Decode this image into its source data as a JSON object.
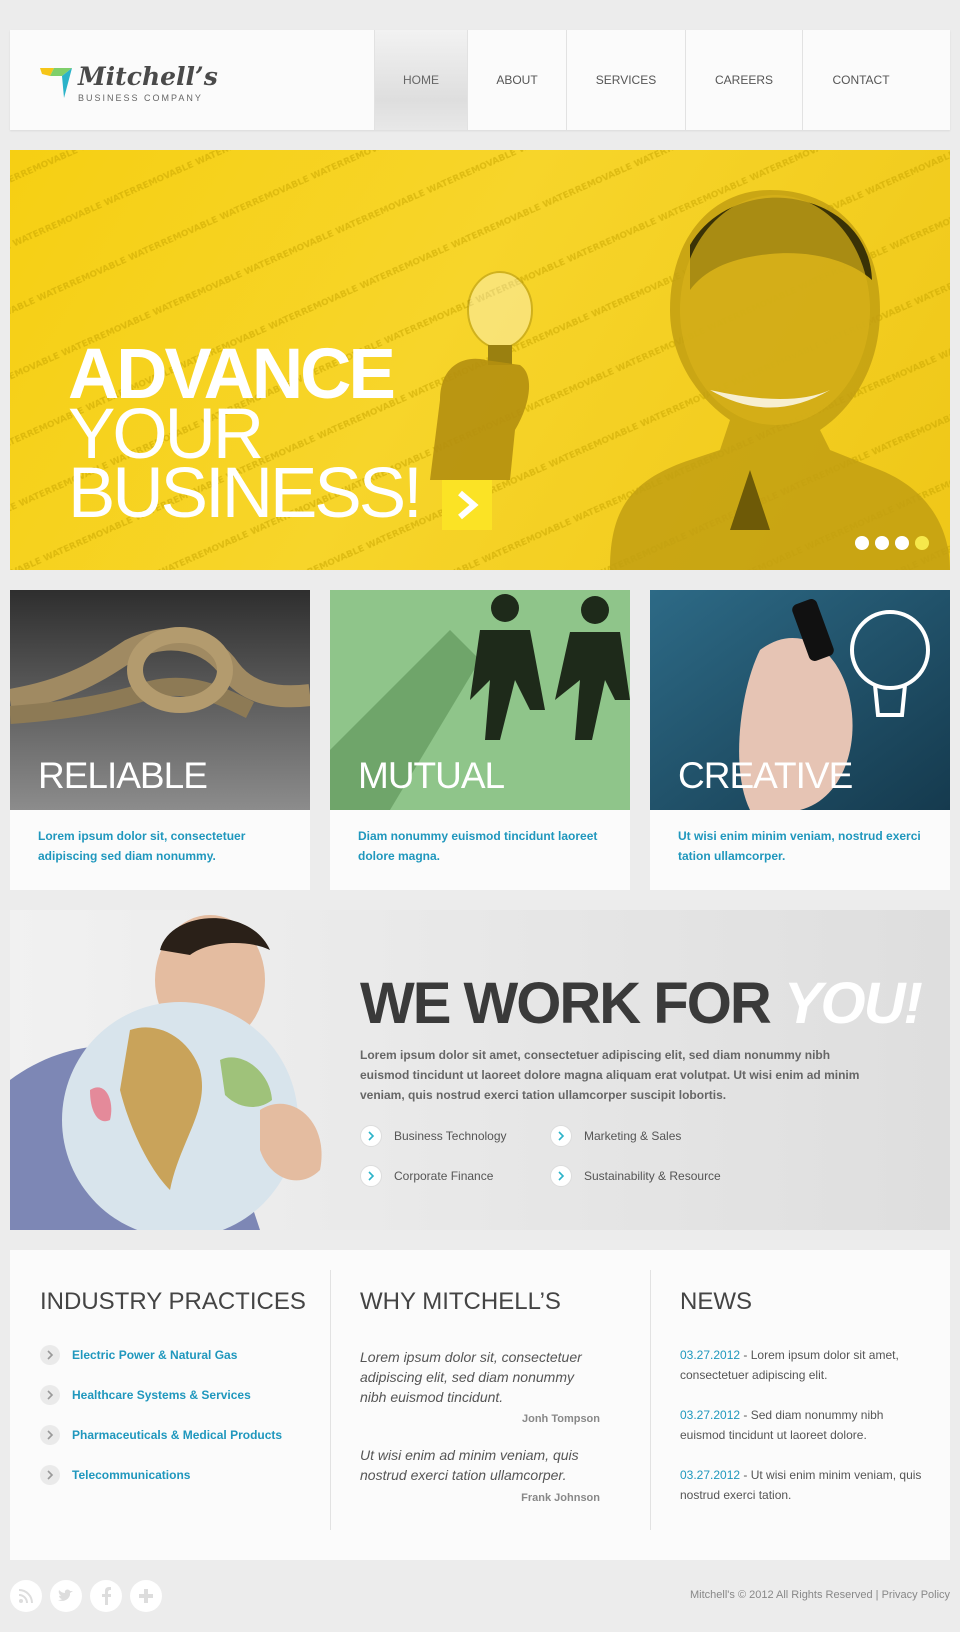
{
  "header": {
    "logo_title": "Mitchell’s",
    "logo_sub": "BUSINESS COMPANY",
    "nav": [
      "HOME",
      "ABOUT",
      "SERVICES",
      "CAREERS",
      "CONTACT"
    ]
  },
  "hero": {
    "line1": "ADVANCE",
    "line2": "YOUR",
    "line3": "BUSINESS!",
    "watermark": "REMOVABLE WATERMARK",
    "slide_count": 4,
    "active_slide": 4
  },
  "features": [
    {
      "title": "RELIABLE",
      "text": "Lorem ipsum dolor sit, consectetuer adipiscing sed diam nonummy."
    },
    {
      "title": "MUTUAL",
      "text": "Diam nonummy euismod tincidunt laoreet dolore magna."
    },
    {
      "title": "CREATIVE",
      "text": "Ut wisi enim minim veniam, nostrud exerci tation ullamcorper."
    }
  ],
  "wework": {
    "title": "WE WORK FOR ",
    "title_accent": "YOU!",
    "text": "Lorem ipsum dolor sit amet, consectetuer adipiscing elit, sed diam nonummy nibh euismod tincidunt ut laoreet dolore magna aliquam erat volutpat. Ut wisi enim ad minim veniam, quis nostrud exerci tation ullamcorper suscipit lobortis.",
    "items": [
      "Business Technology",
      "Marketing & Sales",
      "Corporate Finance",
      "Sustainability & Resource"
    ]
  },
  "industry": {
    "title": "INDUSTRY PRACTICES",
    "items": [
      "Electric Power & Natural Gas",
      "Healthcare Systems & Services",
      "Pharmaceuticals & Medical Products",
      "Telecommunications"
    ]
  },
  "why": {
    "title": "WHY MITCHELL’S",
    "quotes": [
      {
        "text": "Lorem ipsum dolor sit, consectetuer adipiscing elit, sed diam nonummy nibh euismod tincidunt.",
        "author": "Jonh Tompson"
      },
      {
        "text": "Ut wisi enim ad minim veniam, quis nostrud exerci tation ullamcorper.",
        "author": "Frank Johnson"
      }
    ]
  },
  "news": {
    "title": "NEWS",
    "items": [
      {
        "date": "03.27.2012",
        "text": " - Lorem ipsum dolor sit amet, consectetuer adipiscing elit."
      },
      {
        "date": "03.27.2012",
        "text": " - Sed diam nonummy nibh euismod tincidunt ut laoreet dolore."
      },
      {
        "date": "03.27.2012",
        "text": " - Ut wisi enim minim veniam, quis nostrud exerci tation."
      }
    ]
  },
  "footer": {
    "copyright": "Mitchell's © 2012 All Rights Reserved | ",
    "privacy": "Privacy Policy",
    "social": [
      "rss-icon",
      "twitter-icon",
      "facebook-icon",
      "plus-icon"
    ]
  },
  "colors": {
    "accent": "#1f97bd",
    "hero_yellow": "#f6cf13",
    "text_dark": "#3a3a3a"
  }
}
